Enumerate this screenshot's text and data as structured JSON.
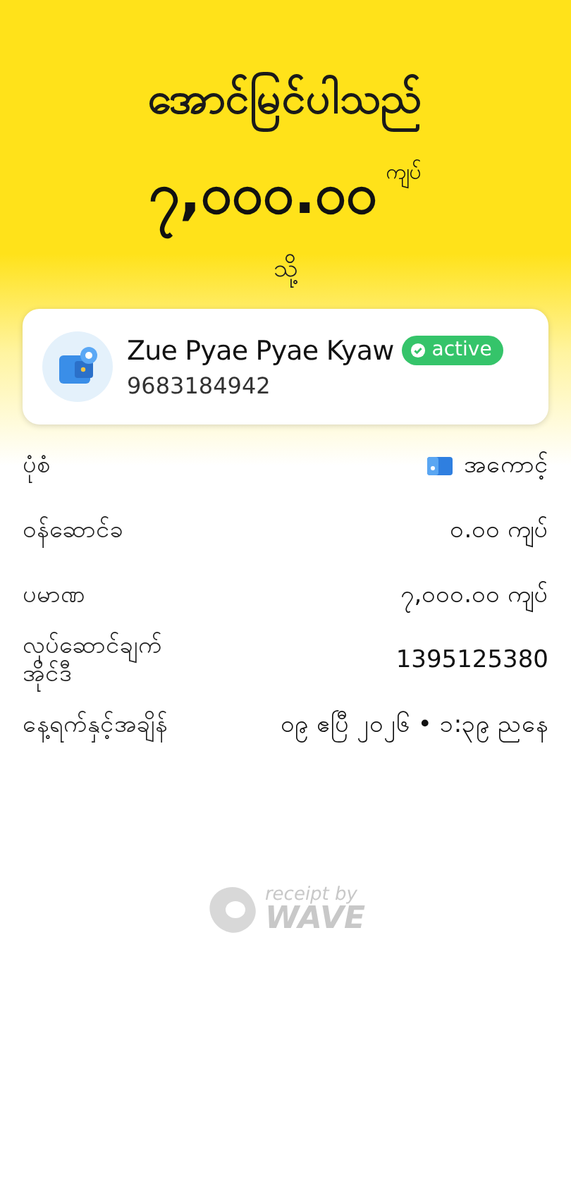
{
  "header": {
    "title": "အောင်မြင်ပါသည်",
    "amount": "၇,၀၀၀.၀၀",
    "currency": "ကျပ်",
    "direction": "သို့"
  },
  "recipient": {
    "name": "Zue Pyae Pyae Kyaw",
    "badge": "active",
    "phone": "9683184942"
  },
  "details": [
    {
      "kind": "icon",
      "label": "ပုံစံ",
      "value": "အကောင့်"
    },
    {
      "kind": "text",
      "label": "ဝန်ဆောင်ခ",
      "value": "၀.၀၀ ကျပ်"
    },
    {
      "kind": "text",
      "label": "ပမာဏ",
      "value": "၇,၀၀၀.၀၀ ကျပ်"
    },
    {
      "kind": "text",
      "label": "လုပ်ဆောင်ချက် အိုင်ဒီ",
      "value": "1395125380"
    },
    {
      "kind": "text",
      "label": "နေ့ရက်နှင့်အချိန်",
      "value": "၀၉ ဧပြီ ၂၀၂၆ • ၁:၃၉ ညနေ"
    }
  ],
  "footer": {
    "caption": "receipt by",
    "brand": "WAVE"
  }
}
